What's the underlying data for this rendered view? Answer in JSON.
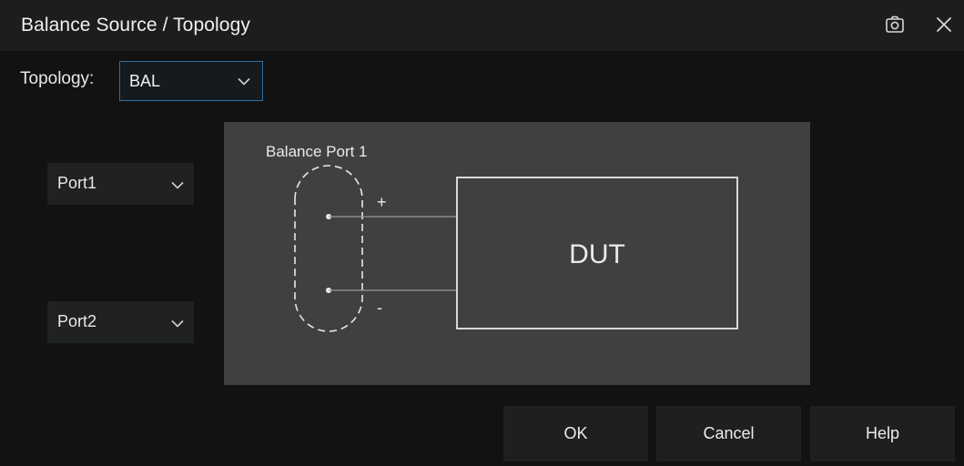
{
  "dialog": {
    "title": "Balance Source / Topology",
    "toolbar_icons": [
      "camera-icon",
      "close-icon"
    ]
  },
  "topology": {
    "label": "Topology:",
    "selected": "BAL"
  },
  "ports": {
    "port1": "Port1",
    "port2": "Port2"
  },
  "diagram": {
    "title": "Balance Port 1",
    "plus": "+",
    "minus": "-",
    "dut": "DUT"
  },
  "buttons": {
    "ok": "OK",
    "cancel": "Cancel",
    "help": "Help"
  },
  "colors": {
    "accent_border": "#2e6ea0",
    "panel": "#404040",
    "background": "#121212"
  }
}
